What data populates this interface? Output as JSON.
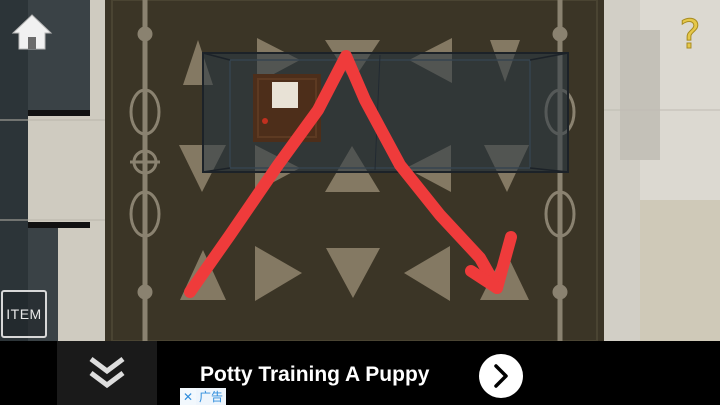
{
  "hud": {
    "home_icon": "home-icon",
    "help_icon": "question-mark-icon",
    "help_glyph": "?",
    "item_label": "ITEM"
  },
  "ad": {
    "title": "Potty Training A Puppy",
    "chevron_icon": "double-chevron-down-icon",
    "go_icon": "chevron-right-icon",
    "close_glyph": "✕",
    "badge_label": "广告"
  },
  "colors": {
    "carpet": "#3b3526",
    "triangle": "#8d816a",
    "ornament": "#8a8270",
    "hint_stroke": "#ef3b3b",
    "help_yellow": "#e6c84a"
  }
}
